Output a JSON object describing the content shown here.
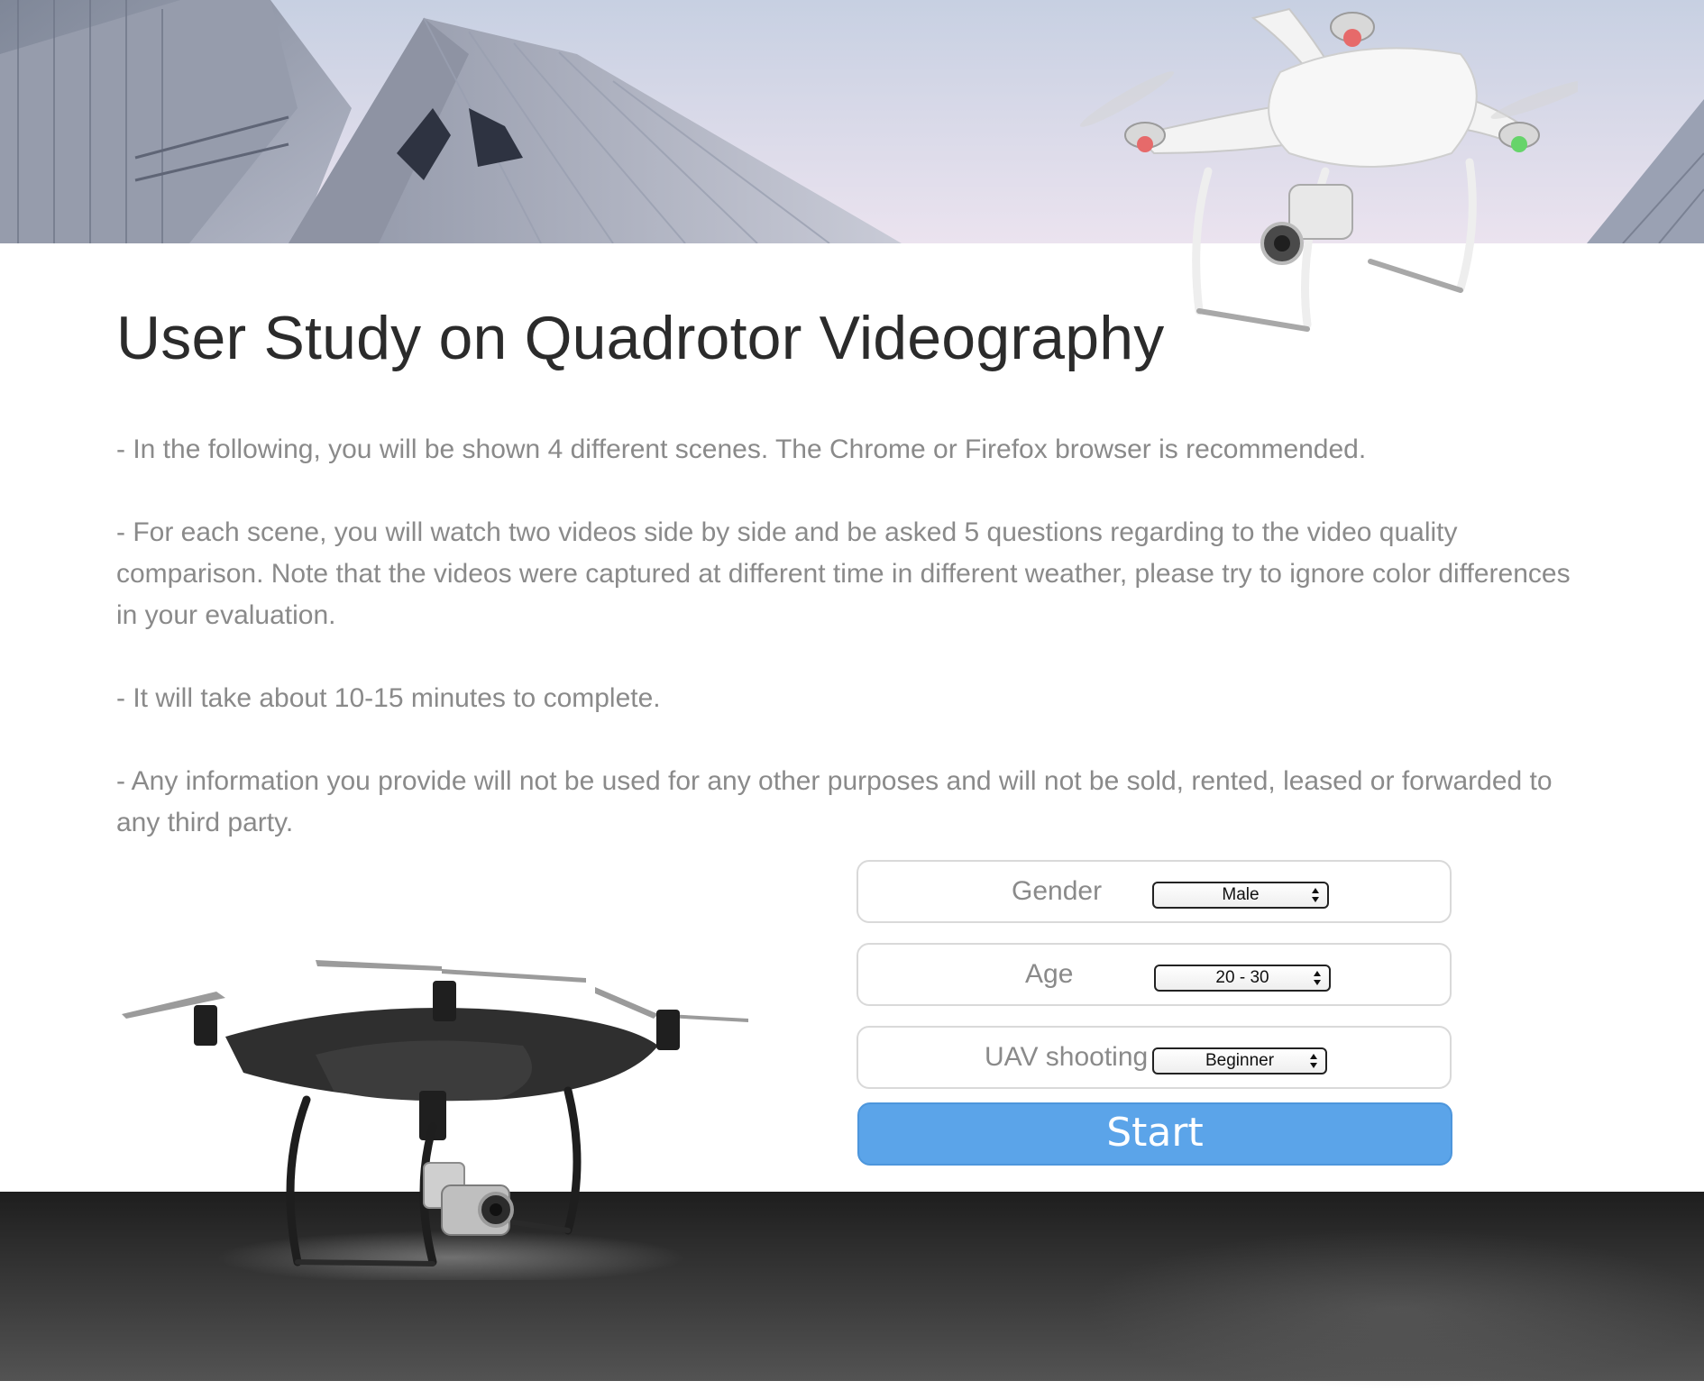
{
  "page": {
    "title": "User Study on Quadrotor Videography",
    "intro": [
      "- In the following, you will be shown 4 different scenes. The Chrome or Firefox browser is recommended.",
      "- For each scene, you will watch two videos side by side and be asked 5 questions regarding to the video quality comparison. Note that the videos were captured at different time in different weather, please try to ignore color differences in your evaluation.",
      "- It will take about 10-15 minutes to complete.",
      "- Any information you provide will not be used for any other purposes and will not be sold, rented, leased or forwarded to any third party."
    ]
  },
  "form": {
    "gender": {
      "label": "Gender",
      "value": "Male"
    },
    "age": {
      "label": "Age",
      "value": "20 - 30"
    },
    "uav": {
      "label": "UAV shooting",
      "value": "Beginner"
    },
    "start_label": "Start"
  },
  "colors": {
    "accent_button": "#5ba4e9",
    "body_text": "#8a8a8a",
    "title_text": "#2b2b2b",
    "footer_dark": "#2a2a2a"
  },
  "images": {
    "hero": "building-rooftop-image",
    "drone_top": "white-quadrotor-drone-image",
    "drone_bottom": "black-quadrotor-drone-image"
  }
}
